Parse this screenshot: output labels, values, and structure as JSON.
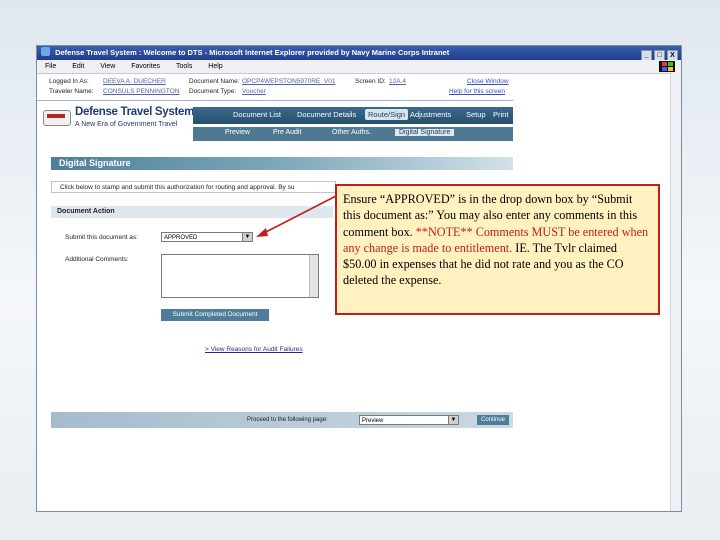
{
  "window": {
    "title": "Defense Travel System : Welcome to DTS - Microsoft Internet Explorer provided by Navy Marine Corps Intranet",
    "controls": [
      "_",
      "□",
      "X"
    ]
  },
  "menu": [
    "File",
    "Edit",
    "View",
    "Favorites",
    "Tools",
    "Help"
  ],
  "info": {
    "logged_in_label": "Logged In As:",
    "logged_in_value": "DEEVA A. DUECHER",
    "traveler_label": "Traveler Name:",
    "traveler_value": "CONSULS PENNINGTON",
    "doc_name_label": "Document Name:",
    "doc_name_value": "OPCP4WEPSTON5970RE_V01",
    "doc_type_label": "Document Type:",
    "doc_type_value": "Voucher",
    "screen_id_label": "Screen ID:",
    "screen_id_value": "12A.4",
    "close_window": "Close Window",
    "help_link": "Help for this screen"
  },
  "brand": {
    "name": "Defense Travel System",
    "tagline": "A New Era of Government Travel"
  },
  "nav": {
    "items": [
      "Document List",
      "Document Details",
      "Route/Sign",
      "Adjustments",
      "Setup",
      "Print"
    ],
    "active": "Route/Sign"
  },
  "subnav": {
    "items": [
      "Preview",
      "Pre Audit",
      "Other Auths.",
      "Digital Signature"
    ],
    "active": "Digital Signature"
  },
  "page": {
    "header": "Digital Signature",
    "instruction": "Click below to stamp and submit this authorization for routing and approval. By su",
    "doc_action": "Document Action",
    "submit_label": "Submit this document as:",
    "submit_value": "APPROVED",
    "comments_label": "Additional Comments:",
    "submit_button": "Submit Completed Document",
    "audit_link": "> View Reasons for Audit Failures",
    "proceed_label": "Proceed to the following page:",
    "proceed_value": "Preview",
    "continue_button": "Continue"
  },
  "callout": {
    "line1": "Ensure “APPROVED” is in the drop down box by “Submit this document as:” You may also enter any comments in this comment box.",
    "note": "**NOTE** Comments MUST be entered when any change is made to entitlement.",
    "line2": "IE. The Tvlr claimed $50.00 in expenses that he did not rate and you as the CO deleted the expense."
  },
  "colors": {
    "titlebar": "#1f3c8a",
    "nav": "#25506e",
    "accent_button": "#4f7c98",
    "callout_border": "#c0201a",
    "callout_bg": "#fff2c0"
  }
}
